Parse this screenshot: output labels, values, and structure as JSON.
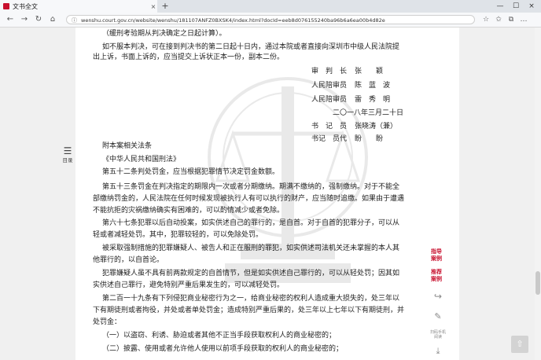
{
  "browser": {
    "tab_title": "文书全文",
    "tab_close": "×",
    "new_tab": "+",
    "win_min": "—",
    "win_max": "☐",
    "win_close": "×",
    "url": "wenshu.court.gov.cn/website/wenshu/181107ANFZ0BXSK4/index.html?docId=eeb8d076155240ba96b6a6ea00b4d82e"
  },
  "doc": {
    "lines": [
      "（缓刑考验期从判决确定之日起计算）。",
      "如不服本判决，可在接到判决书的第二日起十日内，通过本院或者直接向深圳市中级人民法院提",
      "出上诉，书面上诉的，应当提交上诉状正本一份，副本二份。"
    ],
    "signatures": [
      {
        "role": "审　判　长",
        "name": "张　　颖"
      },
      {
        "role": "人民陪审员",
        "name": "陈　蓝　波"
      },
      {
        "role": "人民陪审员",
        "name": "雷　秀　明"
      }
    ],
    "date": "二〇一八年三月二十日",
    "clerks": [
      {
        "role": "书　记　员",
        "name": "张晓涛（兼）"
      },
      {
        "role": "书记　员代",
        "name": "盼　　盼"
      }
    ],
    "appendix": [
      "附本案相关法条",
      "《中华人民共和国刑法》",
      "第五十二条判处罚金，应当根据犯罪情节决定罚金数额。",
      "第五十三条罚金在判决指定的期限内一次或者分期缴纳。期满不缴纳的，强制缴纳。对于不能全",
      "部缴纳罚金的，人民法院在任何时候发现被执行人有可以执行的财产，应当随时追缴。如果由于遭遇",
      "不能抗拒的灾祸缴纳确实有困难的，可以酌情减少或者免除。",
      "第六十七条犯罪以后自动投案，如实供述自己的罪行的，是自首。对于自首的犯罪分子，可以从",
      "轻或者减轻处罚。其中，犯罪较轻的，可以免除处罚。",
      "被采取强制措施的犯罪嫌疑人、被告人和正在服刑的罪犯，如实供述司法机关还未掌握的本人其",
      "他罪行的，以自首论。",
      "犯罪嫌疑人虽不具有前两款规定的自首情节，但是如实供述自己罪行的，可以从轻处罚；因其如",
      "实供述自己罪行，避免特别严重后果发生的，可以减轻处罚。",
      "第二百一十九条有下列侵犯商业秘密行为之一，给商业秘密的权利人造成重大损失的，处三年以",
      "下有期徒刑或者拘役，并处或者单处罚金；造成特别严重后果的，处三年以上七年以下有期徒刑，并",
      "处罚金：",
      "（一）以盗窃、利诱、胁迫或者其他不正当手段获取权利人的商业秘密的；",
      "（二）披露、使用或者允许他人使用以前项手段获取的权利人的商业秘密的；"
    ]
  },
  "sidebar": {
    "toc_label": "目录",
    "guide_label": "指导案例",
    "recommend_label": "推荐案例",
    "share_label": "分享",
    "note_label": "笔记",
    "mobile_label": "扫码手机阅读",
    "download_label": "下载"
  }
}
